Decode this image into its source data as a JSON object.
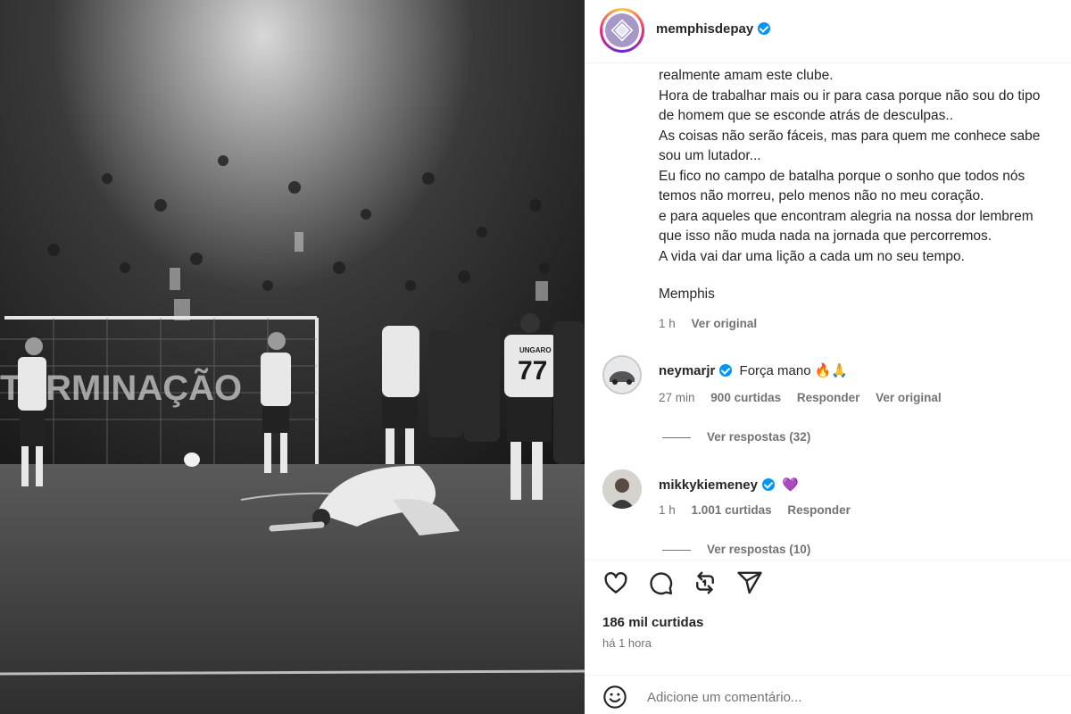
{
  "post": {
    "author": "memphisdepay",
    "author_verified": true,
    "photo_banner_text": "TERMINAÇÃO",
    "jersey_number": "77",
    "jersey_name": "UNGARO",
    "caption_lines": [
      "realmente amam este clube.",
      "Hora de trabalhar mais ou ir para casa porque não sou do tipo",
      "de homem que se esconde atrás de desculpas..",
      "As coisas não serão fáceis, mas para quem me conhece sabe",
      "sou um lutador...",
      "Eu fico no campo de batalha porque o sonho que todos nós",
      "temos não morreu, pelo menos não no meu coração.",
      "e para aqueles que encontram alegria na nossa dor lembrem",
      "que isso não muda nada na jornada que percorremos.",
      "A vida vai dar uma lição a cada um no seu tempo."
    ],
    "signature": "Memphis",
    "caption_time": "1 h",
    "caption_see_original": "Ver original",
    "likes": "186 mil curtidas",
    "posted_ago": "há 1 hora"
  },
  "comments": [
    {
      "user": "neymarjr",
      "verified": true,
      "text": "Força mano 🔥🙏",
      "time": "27 min",
      "likes": "900 curtidas",
      "reply": "Responder",
      "see_original": "Ver original",
      "view_replies": "Ver respostas (32)"
    },
    {
      "user": "mikkykiemeney",
      "verified": true,
      "text": "💜",
      "time": "1 h",
      "likes": "1.001 curtidas",
      "reply": "Responder",
      "see_original": "",
      "view_replies": "Ver respostas (10)"
    }
  ],
  "actions": {
    "like_icon": "heart-icon",
    "comment_icon": "comment-icon",
    "share_icon": "repost-icon",
    "send_icon": "send-icon"
  },
  "comment_box": {
    "placeholder": "Adicione um comentário..."
  },
  "colors": {
    "verified_blue": "#0095f6",
    "text_primary": "#262626",
    "text_secondary": "#737373"
  }
}
